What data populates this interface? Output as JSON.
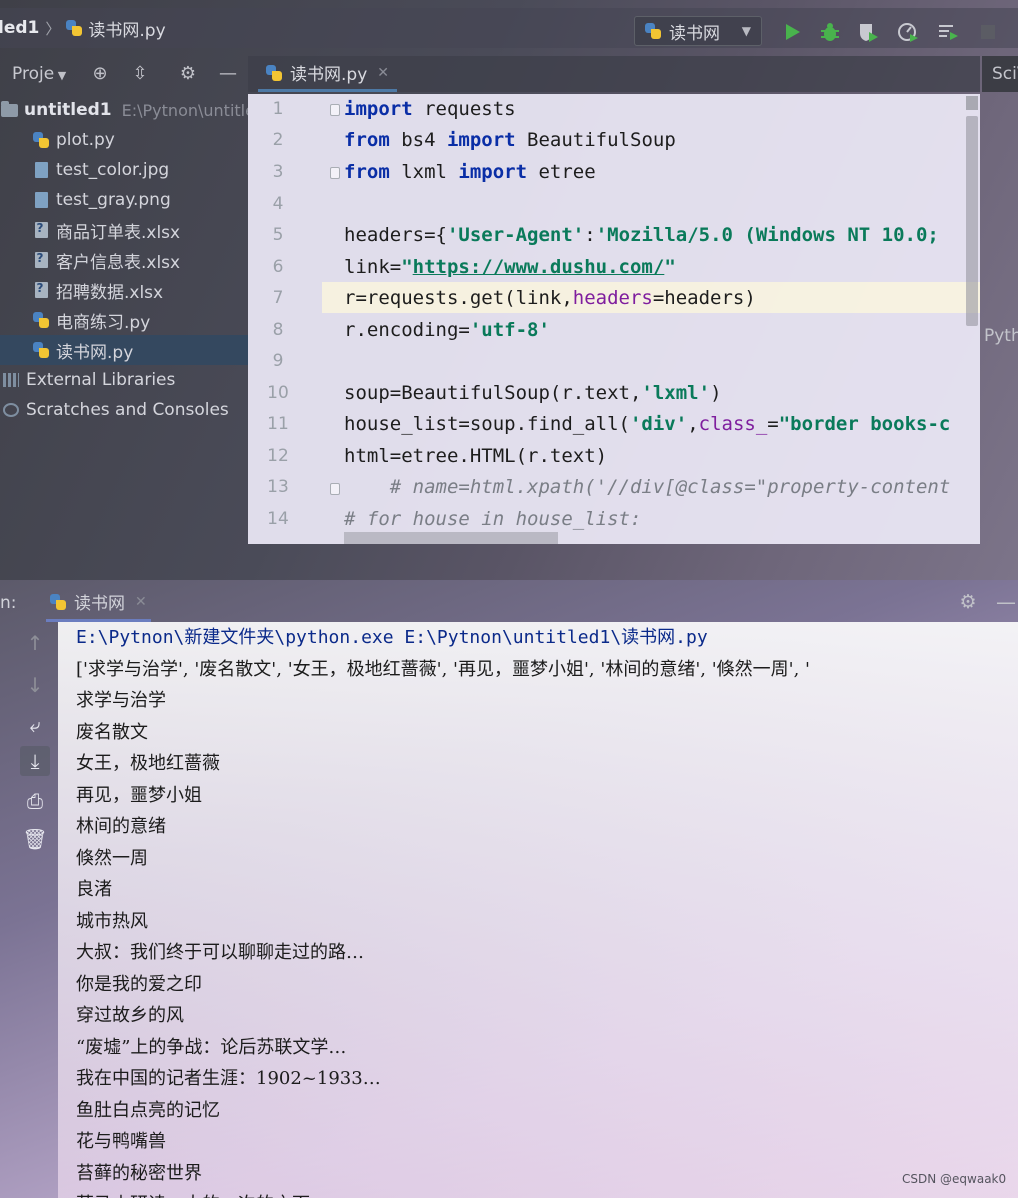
{
  "navbar": {
    "project": "led1",
    "file": "读书网.py",
    "run_config": "读书网"
  },
  "project_panel": {
    "title": "Proje",
    "root": {
      "name": "untitled1",
      "path": "E:\\Pytnon\\untitled1"
    },
    "files": [
      "plot.py",
      "test_color.jpg",
      "test_gray.png",
      "商品订单表.xlsx",
      "客户信息表.xlsx",
      "招聘数据.xlsx",
      "电商练习.py",
      "读书网.py"
    ],
    "external_libraries": "External Libraries",
    "scratches": "Scratches and Consoles"
  },
  "editor": {
    "tab": "读书网.py",
    "sciview": "SciV",
    "side_label": "Pyth",
    "line_numbers": [
      "1",
      "2",
      "3",
      "4",
      "5",
      "6",
      "7",
      "8",
      "9",
      "10",
      "11",
      "12",
      "13",
      "14"
    ],
    "code": {
      "l1_kw": "import",
      "l1_rest": " requests",
      "l2_kw1": "from",
      "l2_mid": " bs4 ",
      "l2_kw2": "import",
      "l2_rest": " BeautifulSoup",
      "l3_kw1": "from",
      "l3_mid": " lxml ",
      "l3_kw2": "import",
      "l3_rest": " etree",
      "l5_a": "headers={",
      "l5_s1": "'User-Agent'",
      "l5_b": ":",
      "l5_s2": "'Mozilla/5.0 (Windows NT 10.0; ",
      "l6_a": "link=",
      "l6_q1": "\"",
      "l6_url": "https://www.dushu.com/",
      "l6_q2": "\"",
      "l7_a": "r=requests.get(link,",
      "l7_p": "headers",
      "l7_b": "=headers)",
      "l8_a": "r.encoding=",
      "l8_s": "'utf-8'",
      "l10_a": "soup=BeautifulSoup(r.text,",
      "l10_s": "'lxml'",
      "l10_b": ")",
      "l11_a": "house_list=soup.find_all(",
      "l11_s1": "'div'",
      "l11_b": ",",
      "l11_p": "class_",
      "l11_c": "=",
      "l11_s2": "\"border books-c",
      "l12": "html=etree.HTML(r.text)",
      "l13": "    # name=html.xpath('//div[@class=\"property-content",
      "l14": "# for house in house_list:"
    }
  },
  "run_panel": {
    "label": "n:",
    "tab": "读书网",
    "console": [
      "E:\\Pytnon\\新建文件夹\\python.exe E:\\Pytnon\\untitled1\\读书网.py",
      "['求学与治学', '废名散文', '女王，极地红蔷薇', '再见，噩梦小姐', '林间的意绪', '倏然一周', '",
      "求学与治学",
      "废名散文",
      "女王，极地红蔷薇",
      "再见，噩梦小姐",
      "林间的意绪",
      "倏然一周",
      "良渚",
      "城市热风",
      "大叔：我们终于可以聊聊走过的路…",
      "你是我的爱之印",
      "穿过故乡的风",
      "“废墟”上的争战：论后苏联文学…",
      "我在中国的记者生涯：1902~1933…",
      "鱼肚白点亮的记忆",
      "花与鸭嘴兽",
      "苔藓的秘密世界",
      "莫马山研读，大的一次的之面"
    ]
  },
  "watermark": "CSDN @eqwaak0",
  "colors": {
    "keyword": "#0a2ea6",
    "string": "#0a7a5a",
    "param": "#7f1e9e",
    "selection": "#34485f"
  }
}
